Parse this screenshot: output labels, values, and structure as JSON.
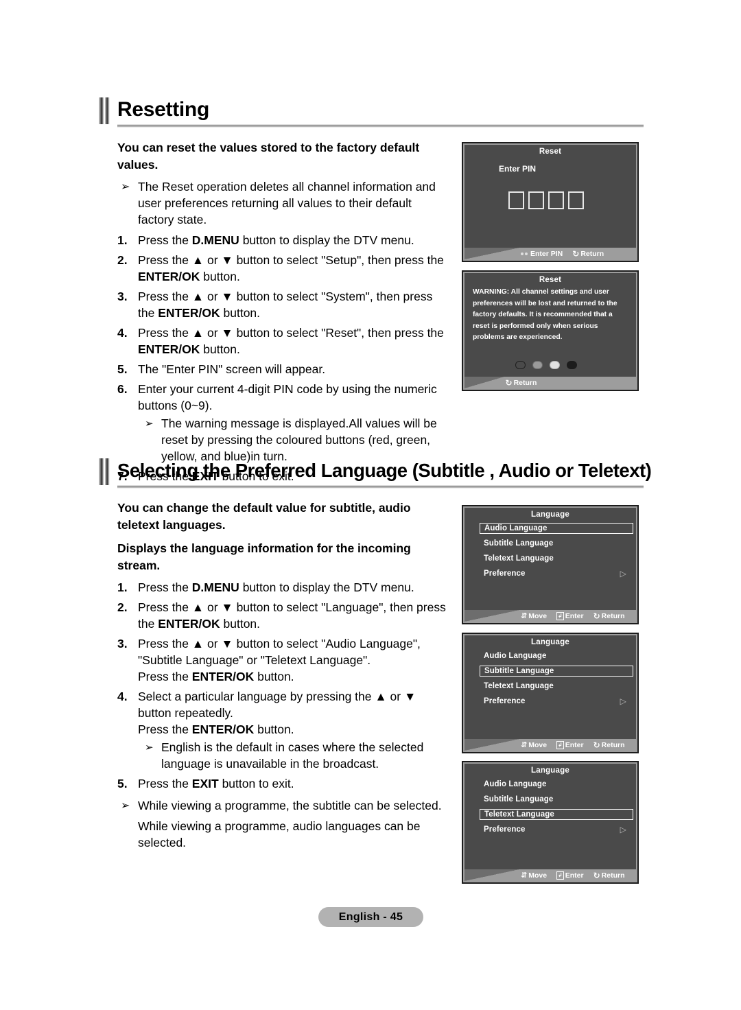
{
  "document": {
    "footer_label": "English - 45"
  },
  "section1": {
    "title": "Resetting",
    "lead": "You can reset the values stored to the factory default values.",
    "note_marker": "➢",
    "note": "The Reset operation deletes all channel information and user preferences returning all values to their default factory state.",
    "steps": [
      {
        "num": "1.",
        "parts": [
          {
            "t": "Press the ",
            "b": false
          },
          {
            "t": "D.MENU",
            "b": true
          },
          {
            "t": " button to display the DTV menu.",
            "b": false
          }
        ]
      },
      {
        "num": "2.",
        "parts": [
          {
            "t": "Press the ▲ or ▼ button to select \"Setup\", then press the ",
            "b": false
          },
          {
            "t": "ENTER/OK",
            "b": true
          },
          {
            "t": " button.",
            "b": false
          }
        ]
      },
      {
        "num": "3.",
        "parts": [
          {
            "t": "Press the ▲ or ▼ button to select \"System\", then press the ",
            "b": false
          },
          {
            "t": "ENTER/OK",
            "b": true
          },
          {
            "t": " button.",
            "b": false
          }
        ]
      },
      {
        "num": "4.",
        "parts": [
          {
            "t": "Press the ▲ or ▼ button to select \"Reset\", then press the ",
            "b": false
          },
          {
            "t": "ENTER/OK",
            "b": true
          },
          {
            "t": " button.",
            "b": false
          }
        ]
      },
      {
        "num": "5.",
        "parts": [
          {
            "t": "The \"Enter PIN\" screen will appear.",
            "b": false
          }
        ]
      },
      {
        "num": "6.",
        "parts": [
          {
            "t": "Enter your current 4-digit PIN code by using the numeric buttons (0~9).",
            "b": false
          }
        ],
        "subnote_marker": "➢",
        "subnote": "The warning message is displayed.All values will be reset by pressing the coloured buttons (red, green, yellow, and blue)in turn."
      },
      {
        "num": "7.",
        "parts": [
          {
            "t": "Press the ",
            "b": false
          },
          {
            "t": "EXIT",
            "b": true
          },
          {
            "t": " button to exit.",
            "b": false
          }
        ]
      }
    ]
  },
  "section2": {
    "title": "Selecting the Preferred Language (Subtitle , Audio or Teletext)",
    "lead": "You can change the default value for subtitle, audio teletext languages.",
    "lead2": "Displays the language information for the incoming stream.",
    "steps": [
      {
        "num": "1.",
        "parts": [
          {
            "t": "Press the ",
            "b": false
          },
          {
            "t": "D.MENU",
            "b": true
          },
          {
            "t": " button to display the DTV menu.",
            "b": false
          }
        ]
      },
      {
        "num": "2.",
        "parts": [
          {
            "t": "Press the ▲ or ▼ button to select \"Language\", then press the ",
            "b": false
          },
          {
            "t": "ENTER/OK",
            "b": true
          },
          {
            "t": " button.",
            "b": false
          }
        ]
      },
      {
        "num": "3.",
        "parts": [
          {
            "t": "Press the ▲ or ▼ button to select \"Audio Language\", \"Subtitle Language\" or \"Teletext Language\".",
            "b": false
          },
          {
            "t": "\n",
            "b": false
          },
          {
            "t": "Press the ",
            "b": false
          },
          {
            "t": "ENTER/OK",
            "b": true
          },
          {
            "t": " button.",
            "b": false
          }
        ]
      },
      {
        "num": "4.",
        "parts": [
          {
            "t": "Select a particular language by pressing the ▲ or ▼ button repeatedly.",
            "b": false
          },
          {
            "t": "\n",
            "b": false
          },
          {
            "t": "Press the ",
            "b": false
          },
          {
            "t": "ENTER/OK",
            "b": true
          },
          {
            "t": " button.",
            "b": false
          }
        ],
        "subnote_marker": "➢",
        "subnote": "English is the default in cases where the selected language is unavailable in the broadcast."
      },
      {
        "num": "5.",
        "parts": [
          {
            "t": "Press the ",
            "b": false
          },
          {
            "t": "EXIT",
            "b": true
          },
          {
            "t": " button to exit.",
            "b": false
          }
        ]
      }
    ],
    "note_marker": "➢",
    "note": "While viewing a programme, the subtitle can be selected.",
    "note_extra": "While viewing a programme, audio languages can be selected."
  },
  "osd": {
    "pin_panel": {
      "title": "Reset",
      "prompt": "Enter PIN",
      "pin_digits": [
        "",
        "",
        "",
        ""
      ],
      "footer": [
        {
          "icon": "two-dots-icon",
          "label": "Enter PIN"
        },
        {
          "icon": "return-icon",
          "label": "Return"
        }
      ]
    },
    "warning_panel": {
      "title": "Reset",
      "message": "WARNING: All channel settings and user preferences will be lost and returned to the factory defaults. It is recommended that a reset is performed only when serious problems are experienced.",
      "colour_buttons": [
        {
          "name": "red-button",
          "color": "#4a4a4a"
        },
        {
          "name": "green-button",
          "color": "#9a9a9a"
        },
        {
          "name": "yellow-button",
          "color": "#e2e2e2"
        },
        {
          "name": "blue-button",
          "color": "#1c1c1c"
        }
      ],
      "footer": [
        {
          "icon": "return-icon",
          "label": "Return"
        }
      ]
    },
    "language_panels": [
      {
        "title": "Language",
        "items": [
          {
            "label": "Audio Language",
            "selected": true,
            "arrow": false
          },
          {
            "label": "Subtitle Language",
            "selected": false,
            "arrow": false
          },
          {
            "label": "Teletext Language",
            "selected": false,
            "arrow": false
          },
          {
            "label": "Preference",
            "selected": false,
            "arrow": true
          }
        ],
        "footer": [
          {
            "icon": "move-icon",
            "label": "Move"
          },
          {
            "icon": "enter-icon",
            "label": "Enter"
          },
          {
            "icon": "return-icon",
            "label": "Return"
          }
        ]
      },
      {
        "title": "Language",
        "items": [
          {
            "label": "Audio Language",
            "selected": false,
            "arrow": false
          },
          {
            "label": "Subtitle Language",
            "selected": true,
            "arrow": false
          },
          {
            "label": "Teletext Language",
            "selected": false,
            "arrow": false
          },
          {
            "label": "Preference",
            "selected": false,
            "arrow": true
          }
        ],
        "footer": [
          {
            "icon": "move-icon",
            "label": "Move"
          },
          {
            "icon": "enter-icon",
            "label": "Enter"
          },
          {
            "icon": "return-icon",
            "label": "Return"
          }
        ]
      },
      {
        "title": "Language",
        "items": [
          {
            "label": "Audio Language",
            "selected": false,
            "arrow": false
          },
          {
            "label": "Subtitle Language",
            "selected": false,
            "arrow": false
          },
          {
            "label": "Teletext Language",
            "selected": true,
            "arrow": false
          },
          {
            "label": "Preference",
            "selected": false,
            "arrow": true
          }
        ],
        "footer": [
          {
            "icon": "move-icon",
            "label": "Move"
          },
          {
            "icon": "enter-icon",
            "label": "Enter"
          },
          {
            "icon": "return-icon",
            "label": "Return"
          }
        ]
      }
    ]
  }
}
